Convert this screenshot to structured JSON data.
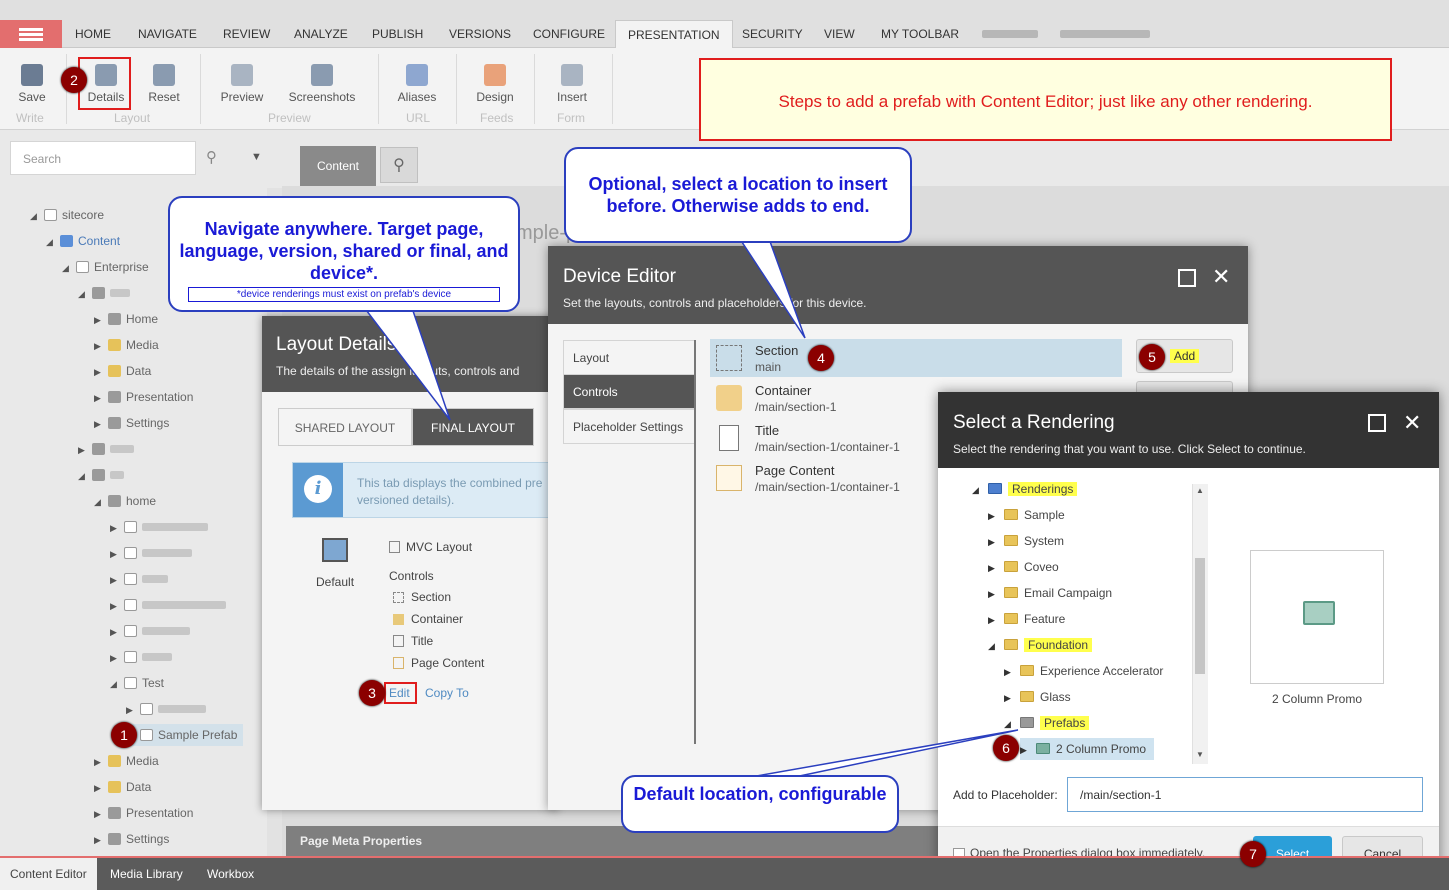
{
  "ribbon": {
    "tabs": [
      "HOME",
      "NAVIGATE",
      "REVIEW",
      "ANALYZE",
      "PUBLISH",
      "VERSIONS",
      "CONFIGURE",
      "PRESENTATION",
      "SECURITY",
      "VIEW",
      "MY TOOLBAR"
    ],
    "active_tab": "PRESENTATION",
    "buttons": {
      "save": "Save",
      "details": "Details",
      "reset": "Reset",
      "preview": "Preview",
      "screenshots": "Screenshots",
      "aliases": "Aliases",
      "design": "Design",
      "insert": "Insert"
    },
    "groups": {
      "write": "Write",
      "layout": "Layout",
      "preview": "Preview",
      "url": "URL",
      "feeds": "Feeds",
      "form": "Form"
    }
  },
  "search": {
    "placeholder": "Search"
  },
  "tree": {
    "sitecore": "sitecore",
    "content": "Content",
    "enterprise": "Enterprise",
    "home": "Home",
    "media": "Media",
    "data": "Data",
    "presentation": "Presentation",
    "settings": "Settings",
    "home_lower": "home",
    "test": "Test",
    "sample_prefab": "Sample Prefab"
  },
  "content": {
    "tab": "Content",
    "ghost_title": "mple-p",
    "page_meta": "Page Meta Properties"
  },
  "layout_details": {
    "title": "Layout Details",
    "subtitle": "The details of the assign  layouts, controls and",
    "tabs": [
      "SHARED LAYOUT",
      "FINAL LAYOUT"
    ],
    "info_text_1": "This tab displays the combined pre",
    "info_text_2": "versioned details).",
    "device_label": "Default",
    "layout_name": "MVC Layout",
    "controls_label": "Controls",
    "controls": [
      "Section",
      "Container",
      "Title",
      "Page Content"
    ],
    "edit": "Edit",
    "copy_to": "Copy To"
  },
  "device_editor": {
    "title": "Device Editor",
    "subtitle": "Set the layouts, controls and placeholders for this device.",
    "nav": [
      "Layout",
      "Controls",
      "Placeholder Settings"
    ],
    "renderings": [
      {
        "name": "Section",
        "path": "main"
      },
      {
        "name": "Container",
        "path": "/main/section-1"
      },
      {
        "name": "Title",
        "path": "/main/section-1/container-1"
      },
      {
        "name": "Page Content",
        "path": "/main/section-1/container-1"
      }
    ],
    "add": "Add"
  },
  "select_rendering": {
    "title": "Select a Rendering",
    "subtitle": "Select the rendering that you want to use. Click Select to continue.",
    "tree": {
      "renderings": "Renderings",
      "sample": "Sample",
      "system": "System",
      "coveo": "Coveo",
      "email_campaign": "Email Campaign",
      "feature": "Feature",
      "foundation": "Foundation",
      "experience_accelerator": "Experience Accelerator",
      "glass": "Glass",
      "prefabs": "Prefabs",
      "two_column_promo": "2 Column Promo"
    },
    "preview_label": "2 Column Promo",
    "placeholder_label": "Add to Placeholder:",
    "placeholder_value": "/main/section-1",
    "checkbox_label": "Open the Properties dialog box immediately.",
    "select": "Select",
    "cancel": "Cancel"
  },
  "bottom_tabs": [
    "Content Editor",
    "Media Library",
    "Workbox"
  ],
  "annotations": {
    "note": "Steps to add a prefab with Content Editor; just like any other rendering.",
    "navigate": "Navigate anywhere. Target page, language, version, shared or final, and device*.",
    "navigate_note": "*device renderings must exist on prefab's device",
    "optional": "Optional, select a location to insert before. Otherwise adds to end.",
    "default_location": "Default location, configurable",
    "steps": [
      "1",
      "2",
      "3",
      "4",
      "5",
      "6",
      "7"
    ]
  }
}
